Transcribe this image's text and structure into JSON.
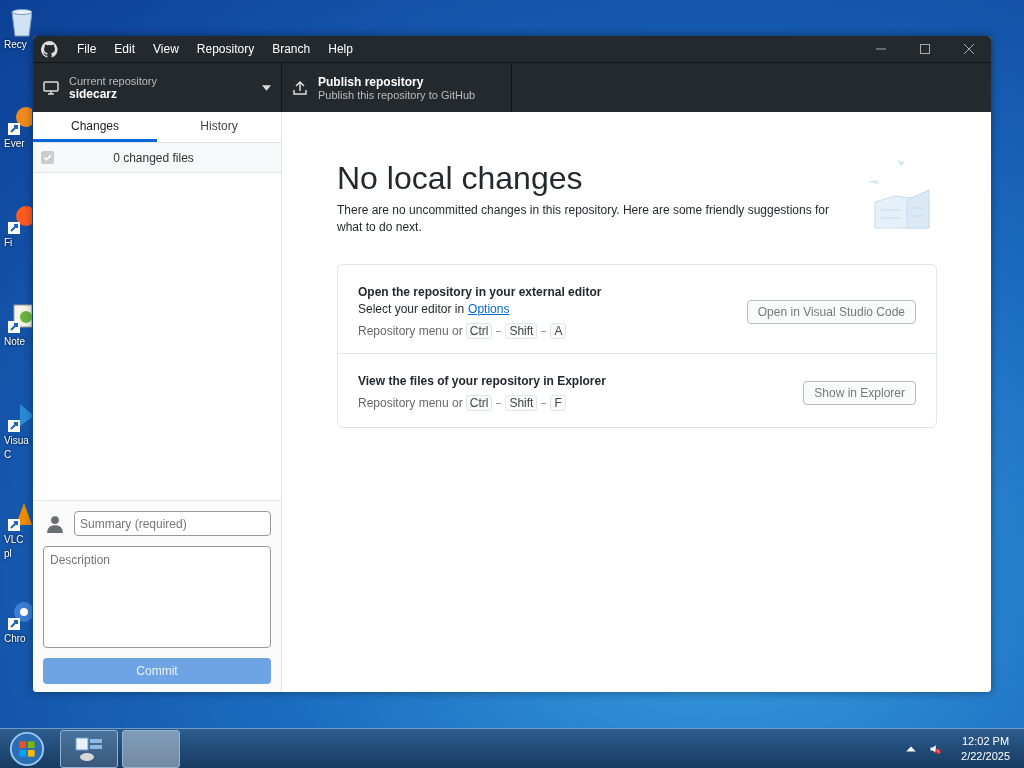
{
  "desktop": {
    "icons": [
      {
        "kind": "recycle",
        "lines": [
          "Recy"
        ]
      },
      {
        "kind": "browser-orange",
        "lines": [
          "Ever"
        ]
      },
      {
        "kind": "browser-fire",
        "lines": [
          "Fi"
        ]
      },
      {
        "kind": "notepad",
        "lines": [
          "Note"
        ]
      },
      {
        "kind": "code",
        "lines": [
          "Visua",
          "C"
        ]
      },
      {
        "kind": "cone",
        "lines": [
          "VLC",
          "pl"
        ]
      },
      {
        "kind": "chrome",
        "lines": [
          "Chro"
        ]
      }
    ]
  },
  "window": {
    "menu": [
      "File",
      "Edit",
      "View",
      "Repository",
      "Branch",
      "Help"
    ],
    "current_repository": {
      "label": "Current repository",
      "name": "sidecarz"
    },
    "publish": {
      "title": "Publish repository",
      "subtitle": "Publish this repository to GitHub"
    },
    "tabs": [
      {
        "label": "Changes",
        "selected": true
      },
      {
        "label": "History",
        "selected": false
      }
    ],
    "changes": {
      "label": "0 changed files",
      "checked": true,
      "disabled": true
    },
    "commit": {
      "summary_placeholder": "Summary (required)",
      "description_placeholder": "Description",
      "button": "Commit",
      "disabled": true
    },
    "main": {
      "heading": "No local changes",
      "description": "There are no uncommitted changes in this repository. Here are some friendly suggestions for what to do next.",
      "suggestions": [
        {
          "title": "Open the repository in your external editor",
          "hint": "Select your editor in",
          "link": "Options",
          "shortcut_prefix": "Repository menu or",
          "keys": [
            "Ctrl",
            "Shift",
            "A"
          ],
          "button": "Open in Visual Studio Code"
        },
        {
          "title": "View the files of your repository in Explorer",
          "shortcut_prefix": "Repository menu or",
          "keys": [
            "Ctrl",
            "Shift",
            "F"
          ],
          "button": "Show in Explorer"
        }
      ]
    }
  },
  "taskbar": {
    "time": "12:02 PM",
    "date": "2/22/2025"
  }
}
